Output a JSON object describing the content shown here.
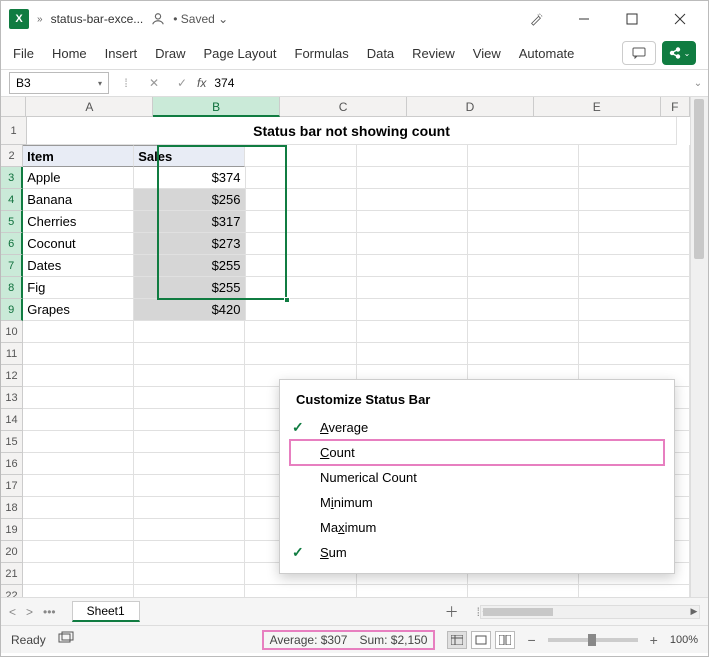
{
  "titlebar": {
    "app_icon_letter": "X",
    "filename": "status-bar-exce...",
    "saved_label": "• Saved",
    "saved_dropdown": "⌄"
  },
  "ribbon": {
    "tabs": [
      "File",
      "Home",
      "Insert",
      "Draw",
      "Page Layout",
      "Formulas",
      "Data",
      "Review",
      "View",
      "Automate"
    ]
  },
  "formula_bar": {
    "name_box": "B3",
    "fx_label": "fx",
    "formula": "374"
  },
  "columns": [
    "A",
    "B",
    "C",
    "D",
    "E",
    "F"
  ],
  "rows": [
    "1",
    "2",
    "3",
    "4",
    "5",
    "6",
    "7",
    "8",
    "9",
    "10",
    "11",
    "12",
    "13",
    "14",
    "15",
    "16",
    "17",
    "18",
    "19",
    "20",
    "21",
    "22"
  ],
  "sheet": {
    "title": "Status bar not showing count",
    "headers": {
      "item": "Item",
      "sales": "Sales"
    },
    "data": [
      {
        "item": "Apple",
        "sales": "$374"
      },
      {
        "item": "Banana",
        "sales": "$256"
      },
      {
        "item": "Cherries",
        "sales": "$317"
      },
      {
        "item": "Coconut",
        "sales": "$273"
      },
      {
        "item": "Dates",
        "sales": "$255"
      },
      {
        "item": "Fig",
        "sales": "$255"
      },
      {
        "item": "Grapes",
        "sales": "$420"
      }
    ]
  },
  "tabs": {
    "sheet_name": "Sheet1"
  },
  "status": {
    "ready": "Ready",
    "average": "Average: $307",
    "sum": "Sum: $2,150",
    "zoom": "100%"
  },
  "context_menu": {
    "title": "Customize Status Bar",
    "items": [
      {
        "label": "Average",
        "underline": 0,
        "checked": true
      },
      {
        "label": "Count",
        "underline": 0,
        "checked": false,
        "highlighted": true
      },
      {
        "label": "Numerical Count",
        "underline": -1,
        "checked": false
      },
      {
        "label": "Minimum",
        "underline": 1,
        "checked": false
      },
      {
        "label": "Maximum",
        "underline": 2,
        "checked": false
      },
      {
        "label": "Sum",
        "underline": 0,
        "checked": true
      }
    ]
  },
  "chart_data": {
    "type": "table",
    "title": "Status bar not showing count",
    "columns": [
      "Item",
      "Sales"
    ],
    "rows": [
      [
        "Apple",
        374
      ],
      [
        "Banana",
        256
      ],
      [
        "Cherries",
        317
      ],
      [
        "Coconut",
        273
      ],
      [
        "Dates",
        255
      ],
      [
        "Fig",
        255
      ],
      [
        "Grapes",
        420
      ]
    ],
    "aggregates": {
      "average": 307,
      "sum": 2150
    }
  }
}
